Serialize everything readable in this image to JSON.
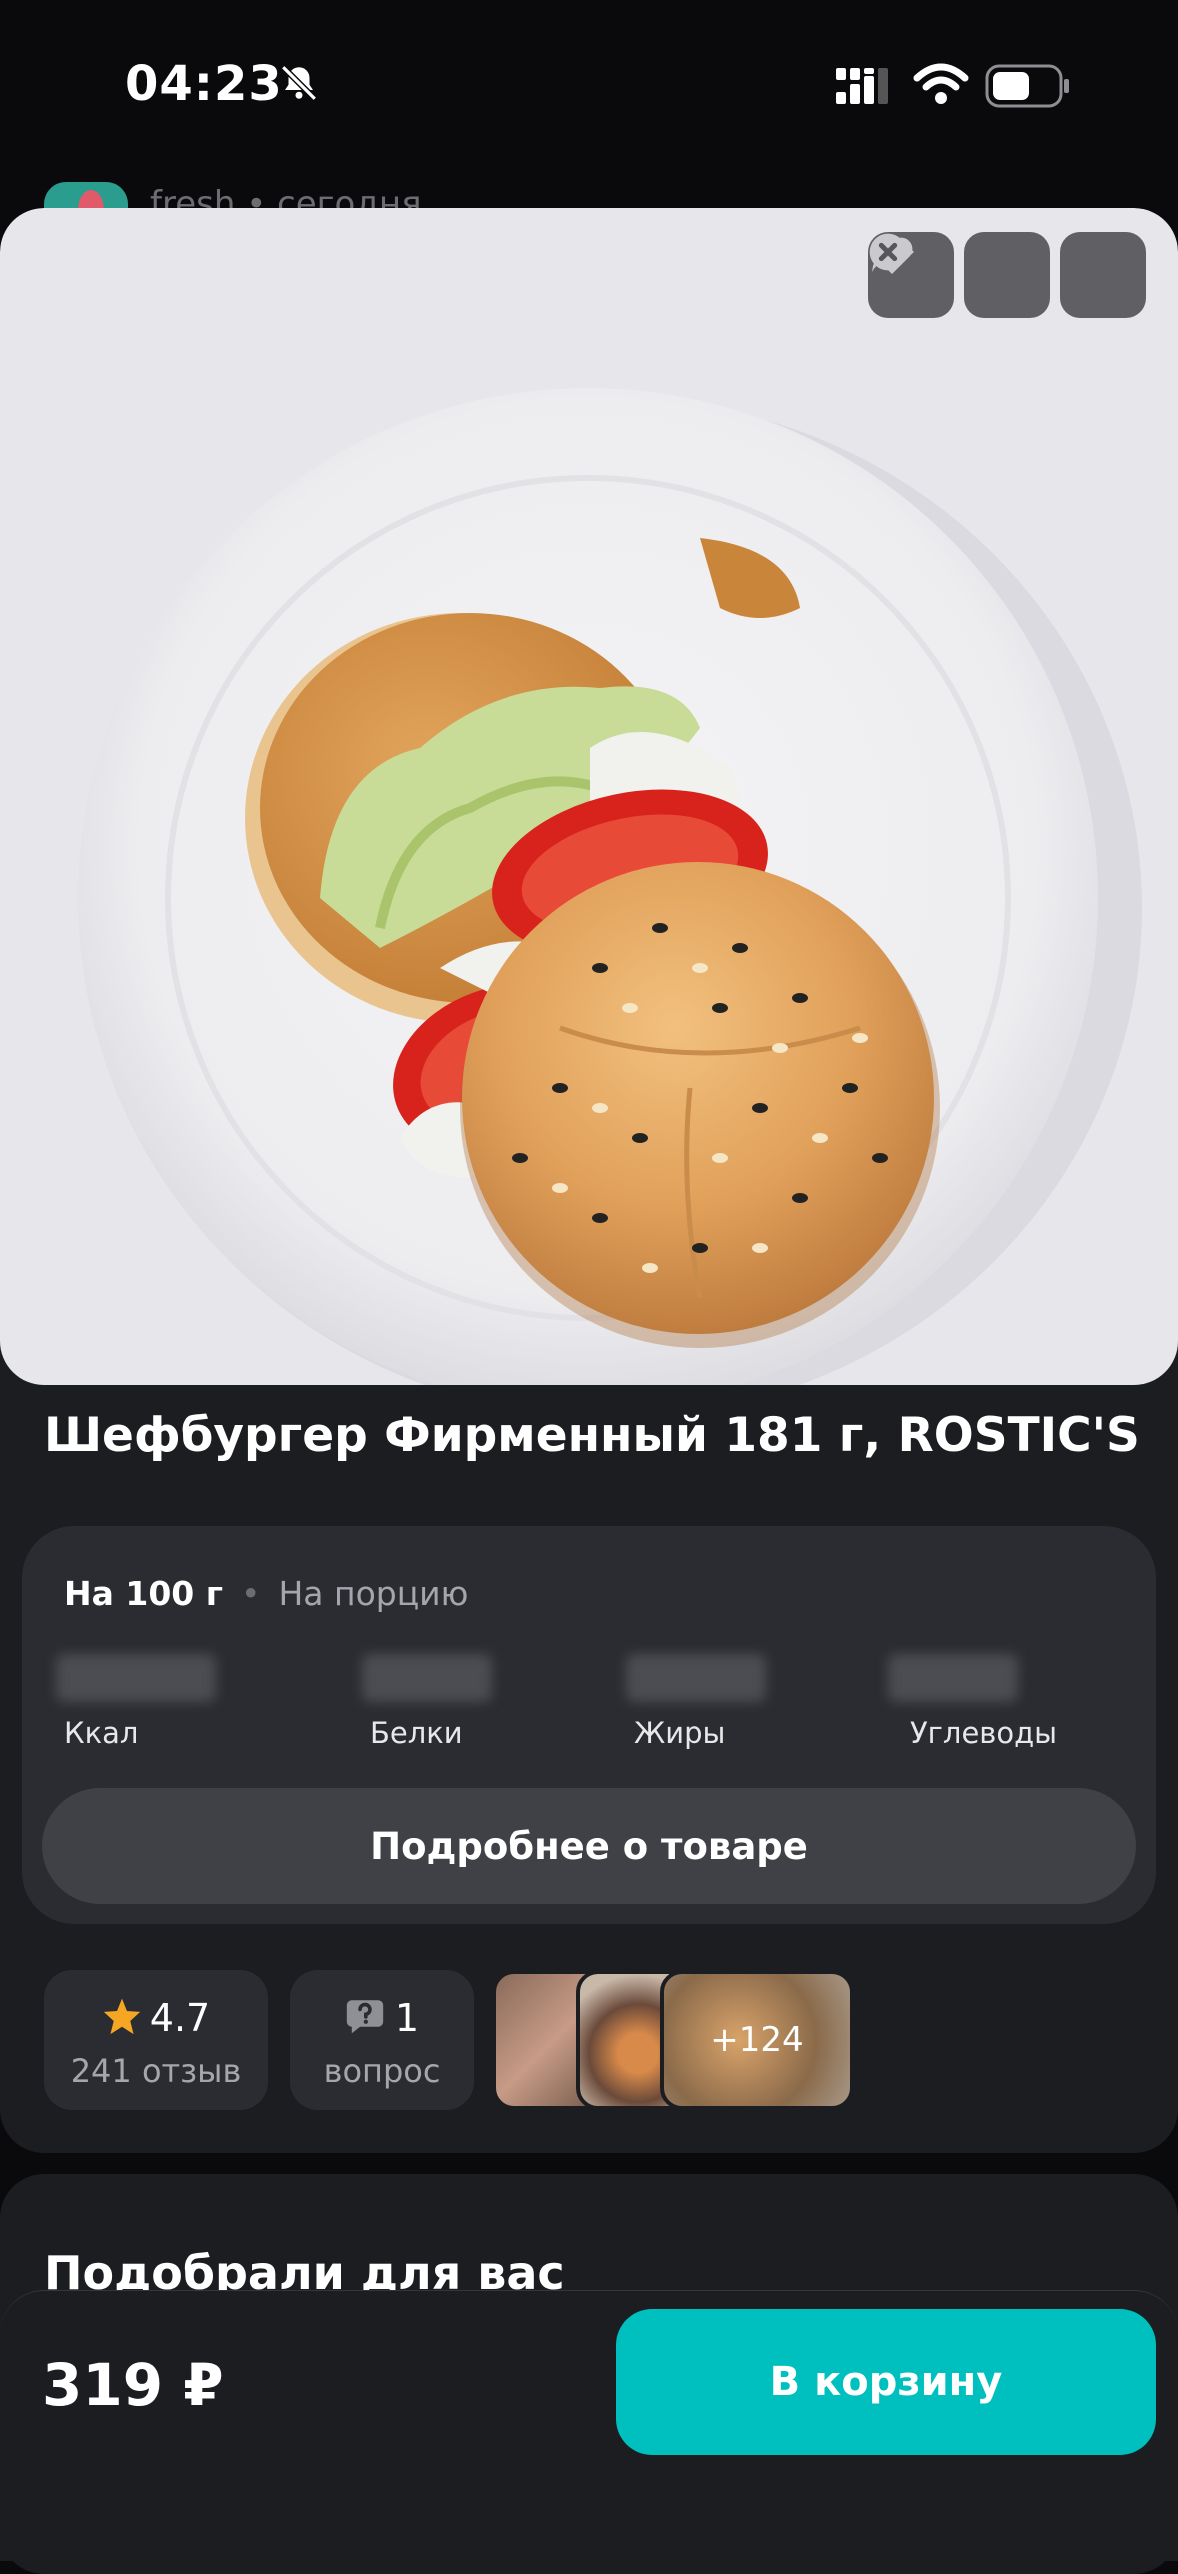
{
  "status_bar": {
    "time": "04:23"
  },
  "behind_sheet": {
    "text": "fresh • сегодня"
  },
  "product": {
    "title": "Шефбургер Фирменный 181 г, ROSTIC'S",
    "image_alt": "burger on plate"
  },
  "nutrition": {
    "tab_active": "На 100 г",
    "tab_separator": "•",
    "tab_inactive": "На порцию",
    "labels": [
      "Ккал",
      "Белки",
      "Жиры",
      "Углеводы"
    ],
    "more_button": "Подробнее о товаре"
  },
  "rating": {
    "value": "4.7",
    "reviews": "241 отзыв"
  },
  "questions": {
    "count": "1",
    "label": "вопрос"
  },
  "photos": {
    "more_count": "+124"
  },
  "recommendations": {
    "title": "Подобрали для вас"
  },
  "bottom": {
    "price": "319 ₽",
    "cart_button": "В корзину"
  },
  "colors": {
    "accent": "#00bfbf",
    "star": "#f5a623",
    "background": "#1b1d21"
  },
  "icons": [
    "bell-slash-icon",
    "signal-icon",
    "wifi-icon",
    "battery-icon",
    "heart-icon",
    "share-icon",
    "close-icon",
    "star-icon",
    "question-icon"
  ]
}
